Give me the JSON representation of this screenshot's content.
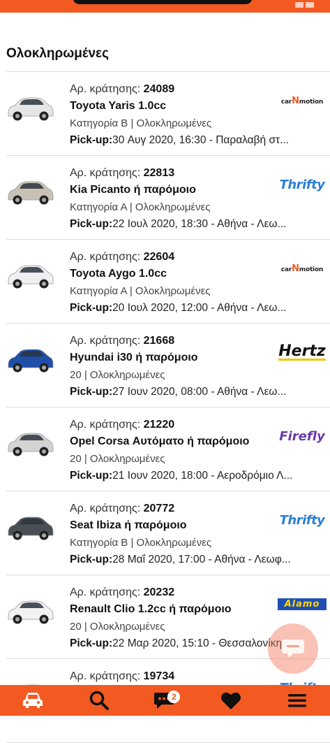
{
  "header": {
    "section_title": "Ολοκληρωμένες"
  },
  "bookings": [
    {
      "number_label": "Αρ. κράτησης:",
      "number": "24089",
      "model": "Toyota Yaris 1.0cc",
      "category": "Κατηγορία Β | Ολοκληρωμένες",
      "pickup_label": "Pick-up:",
      "pickup": "30 Αυγ 2020, 16:30 - Παραλαβή στ...",
      "company_logo": "car N motion",
      "car_color": "#e6e6e6"
    },
    {
      "number_label": "Αρ. κράτησης:",
      "number": "22813",
      "model": "Kia Picanto ή παρόμοιο",
      "category": "Κατηγορία Α | Ολοκληρωμένες",
      "pickup_label": "Pick-up:",
      "pickup": "22 Ιουλ 2020, 18:30 - Αθήνα - Λεω...",
      "company_logo": "Thrifty",
      "car_color": "#c9c2b4"
    },
    {
      "number_label": "Αρ. κράτησης:",
      "number": "22604",
      "model": "Toyota Aygo 1.0cc",
      "category": "Κατηγορία Α | Ολοκληρωμένες",
      "pickup_label": "Pick-up:",
      "pickup": "20 Ιουλ 2020, 12:00 - Αθήνα - Λεω...",
      "company_logo": "car N motion",
      "car_color": "#f0f0f0"
    },
    {
      "number_label": "Αρ. κράτησης:",
      "number": "21668",
      "model": "Hyundai i30 ή παρόμοιο",
      "category": "20 | Ολοκληρωμένες",
      "pickup_label": "Pick-up:",
      "pickup": "27 Ιουν 2020, 08:00 - Αθήνα - Λεω...",
      "company_logo": "Hertz",
      "car_color": "#1f4fa8"
    },
    {
      "number_label": "Αρ. κράτησης:",
      "number": "21220",
      "model": "Opel Corsa Αυτόματο ή παρόμοιο",
      "category": "20 | Ολοκληρωμένες",
      "pickup_label": "Pick-up:",
      "pickup": "21 Ιουν 2020, 18:00 - Αεροδρόμιο Λ...",
      "company_logo": "Firefly",
      "car_color": "#d3d3d3"
    },
    {
      "number_label": "Αρ. κράτησης:",
      "number": "20772",
      "model": "Seat Ibiza ή παρόμοιο",
      "category": "Κατηγορία Β | Ολοκληρωμένες",
      "pickup_label": "Pick-up:",
      "pickup": "28 Μαΐ 2020, 17:00 - Αθήνα - Λεωφ...",
      "company_logo": "Thrifty",
      "car_color": "#4a4e55"
    },
    {
      "number_label": "Αρ. κράτησης:",
      "number": "20232",
      "model": "Renault Clio 1.2cc ή παρόμοιο",
      "category": "20 | Ολοκληρωμένες",
      "pickup_label": "Pick-up:",
      "pickup": "22 Μαρ 2020, 15:10 - Θεσσαλονίκη...",
      "company_logo": "Alamo",
      "car_color": "#f2f2f2"
    },
    {
      "number_label": "Αρ. κράτησης:",
      "number": "19734",
      "model": "",
      "category": "",
      "pickup_label": "",
      "pickup": "",
      "company_logo": "Thrifty",
      "car_color": "#e6e6e6"
    }
  ],
  "tabbar": {
    "messages_badge": "2"
  },
  "colors": {
    "brand": "#f25a22",
    "thrifty": "#2b7fd4",
    "hertz_yellow": "#f2c400",
    "alamo_blue": "#1f4fb5"
  }
}
